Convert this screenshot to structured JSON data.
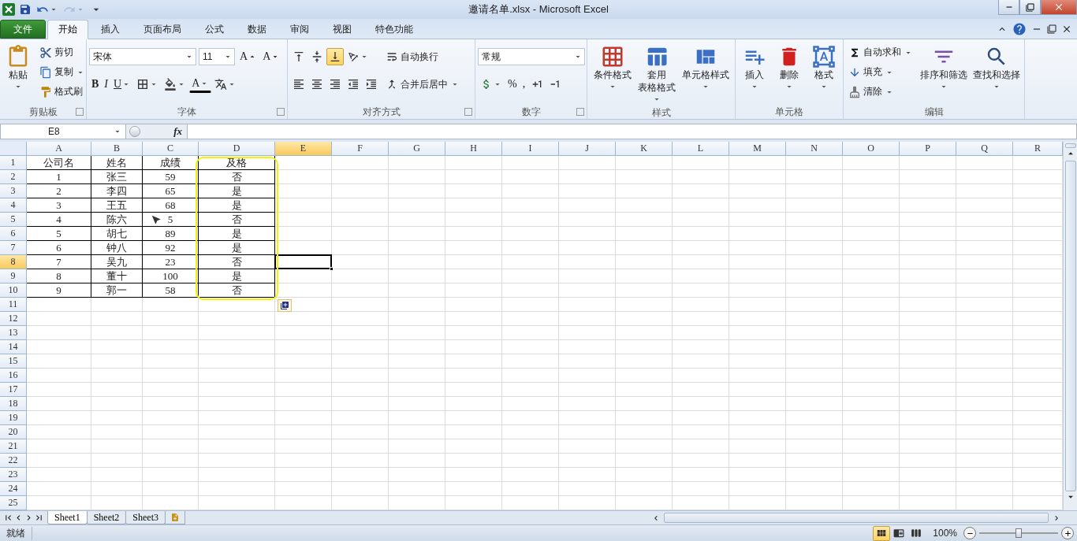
{
  "title_bar": {
    "title": "邀请名单.xlsx - Microsoft Excel",
    "quick_access": [
      {
        "kind": "save",
        "menu": false,
        "disabled": false
      },
      {
        "kind": "undo",
        "menu": true,
        "disabled": false
      },
      {
        "kind": "redo",
        "menu": true,
        "disabled": true
      },
      {
        "kind": "customize",
        "menu": false,
        "disabled": false
      }
    ]
  },
  "tabs": [
    {
      "label": "文件",
      "kind": "file",
      "selected": false
    },
    {
      "label": "开始",
      "kind": "tab",
      "selected": true
    },
    {
      "label": "插入",
      "kind": "tab",
      "selected": false
    },
    {
      "label": "页面布局",
      "kind": "tab",
      "selected": false
    },
    {
      "label": "公式",
      "kind": "tab",
      "selected": false
    },
    {
      "label": "数据",
      "kind": "tab",
      "selected": false
    },
    {
      "label": "审阅",
      "kind": "tab",
      "selected": false
    },
    {
      "label": "视图",
      "kind": "tab",
      "selected": false
    },
    {
      "label": "特色功能",
      "kind": "tab",
      "selected": false
    }
  ],
  "ribbon": [
    {
      "label": "剪贴板",
      "launcher": true,
      "sections": [
        {
          "kind": "large",
          "items": [
            {
              "kind": "paste",
              "lines": [
                "粘贴"
              ],
              "menu": true
            }
          ]
        },
        {
          "kind": "stack",
          "lines": [
            {
              "items": [
                {
                  "kind": "cut",
                  "label": "剪切",
                  "menu": false
                }
              ]
            },
            {
              "items": [
                {
                  "kind": "copy",
                  "label": "复制",
                  "menu": true
                }
              ]
            },
            {
              "items": [
                {
                  "kind": "painter",
                  "label": "格式刷",
                  "menu": false
                }
              ]
            }
          ]
        }
      ]
    },
    {
      "label": "字体",
      "launcher": true,
      "sections": [
        {
          "kind": "stack",
          "lines": [
            {
              "items": [
                {
                  "kind": "combo",
                  "value": "宋体",
                  "wide": true
                },
                {
                  "kind": "combo",
                  "value": "11",
                  "wide": false
                },
                {
                  "kind": "grow",
                  "text": "A",
                  "menu": false,
                  "selected": false
                },
                {
                  "kind": "shrink",
                  "text": "A",
                  "menu": false,
                  "selected": false
                }
              ]
            },
            {
              "items": [
                {
                  "kind": "bold",
                  "text": "B",
                  "menu": false,
                  "selected": false
                },
                {
                  "kind": "italic",
                  "text": "I",
                  "menu": false,
                  "selected": false
                },
                {
                  "kind": "underline",
                  "text": "U",
                  "menu": true,
                  "selected": false
                },
                {
                  "kind": "border",
                  "menu": true,
                  "selected": false
                },
                {
                  "kind": "fill",
                  "menu": true,
                  "selected": false
                },
                {
                  "kind": "fontcolor",
                  "text": "A",
                  "menu": true,
                  "selected": false
                },
                {
                  "kind": "phonetic",
                  "menu": true,
                  "selected": false
                }
              ]
            }
          ]
        }
      ]
    },
    {
      "label": "对齐方式",
      "launcher": true,
      "sections": [
        {
          "kind": "stack",
          "lines": [
            {
              "items": [
                {
                  "kind": "top",
                  "menu": false,
                  "selected": false
                },
                {
                  "kind": "middle",
                  "menu": false,
                  "selected": false
                },
                {
                  "kind": "bottom",
                  "menu": false,
                  "selected": true
                },
                {
                  "kind": "orient",
                  "menu": true,
                  "selected": false
                }
              ]
            },
            {
              "items": [
                {
                  "kind": "left",
                  "menu": false,
                  "selected": false
                },
                {
                  "kind": "center",
                  "menu": false,
                  "selected": false
                },
                {
                  "kind": "right",
                  "menu": false,
                  "selected": false
                },
                {
                  "kind": "outdent",
                  "menu": false,
                  "selected": false
                },
                {
                  "kind": "indent",
                  "menu": false,
                  "selected": false
                }
              ]
            }
          ]
        },
        {
          "kind": "stack",
          "lines": [
            {
              "items": [
                {
                  "kind": "wrap",
                  "label": "自动换行",
                  "menu": false
                }
              ]
            },
            {
              "items": [
                {
                  "kind": "merge",
                  "label": "合并后居中",
                  "menu": true
                }
              ]
            }
          ]
        }
      ]
    },
    {
      "label": "数字",
      "launcher": true,
      "sections": [
        {
          "kind": "stack",
          "lines": [
            {
              "items": [
                {
                  "kind": "combo",
                  "value": "常规",
                  "wide": true
                }
              ]
            },
            {
              "items": [
                {
                  "kind": "currency",
                  "menu": true,
                  "selected": false
                },
                {
                  "kind": "percent",
                  "text": "%",
                  "menu": false,
                  "selected": false
                },
                {
                  "kind": "comma",
                  "text": ",",
                  "menu": false,
                  "selected": false
                },
                {
                  "kind": "incdec",
                  "menu": false,
                  "selected": false
                },
                {
                  "kind": "decdec",
                  "menu": false,
                  "selected": false
                }
              ]
            }
          ]
        }
      ]
    },
    {
      "label": "样式",
      "launcher": false,
      "sections": [
        {
          "kind": "large",
          "items": [
            {
              "kind": "conditional",
              "lines": [
                "条件格式"
              ],
              "menu": true
            },
            {
              "kind": "tableformat",
              "lines": [
                "套用",
                "表格格式"
              ],
              "menu": true
            },
            {
              "kind": "cellstyle",
              "lines": [
                "单元格样式"
              ],
              "menu": true
            }
          ]
        }
      ]
    },
    {
      "label": "单元格",
      "launcher": false,
      "sections": [
        {
          "kind": "large",
          "items": [
            {
              "kind": "insert",
              "lines": [
                "插入"
              ],
              "menu": true
            },
            {
              "kind": "delete",
              "lines": [
                "删除"
              ],
              "menu": true
            },
            {
              "kind": "format",
              "lines": [
                "格式"
              ],
              "menu": true
            }
          ]
        }
      ]
    },
    {
      "label": "编辑",
      "launcher": false,
      "sections": [
        {
          "kind": "stack",
          "lines": [
            {
              "items": [
                {
                  "kind": "sum",
                  "label": "自动求和",
                  "menu": true
                }
              ]
            },
            {
              "items": [
                {
                  "kind": "filldown",
                  "label": "填充",
                  "menu": true
                }
              ]
            },
            {
              "items": [
                {
                  "kind": "clear",
                  "label": "清除",
                  "menu": true
                }
              ]
            }
          ]
        },
        {
          "kind": "large",
          "items": [
            {
              "kind": "sort",
              "lines": [
                "排序和筛选"
              ],
              "menu": true
            },
            {
              "kind": "find",
              "lines": [
                "查找和选择"
              ],
              "menu": true
            }
          ]
        }
      ]
    }
  ],
  "formula_bar": {
    "name_box": "E8",
    "fx": "fx"
  },
  "columns": [
    {
      "label": "A",
      "selected": false,
      "highlighted": false
    },
    {
      "label": "B",
      "selected": false,
      "highlighted": false
    },
    {
      "label": "C",
      "selected": false,
      "highlighted": false
    },
    {
      "label": "D",
      "selected": false,
      "highlighted": true
    },
    {
      "label": "E",
      "selected": true,
      "highlighted": false
    },
    {
      "label": "F",
      "selected": false,
      "highlighted": false
    },
    {
      "label": "G",
      "selected": false,
      "highlighted": false
    },
    {
      "label": "H",
      "selected": false,
      "highlighted": false
    },
    {
      "label": "I",
      "selected": false,
      "highlighted": false
    },
    {
      "label": "J",
      "selected": false,
      "highlighted": false
    },
    {
      "label": "K",
      "selected": false,
      "highlighted": false
    },
    {
      "label": "L",
      "selected": false,
      "highlighted": false
    },
    {
      "label": "M",
      "selected": false,
      "highlighted": false
    },
    {
      "label": "N",
      "selected": false,
      "highlighted": false
    },
    {
      "label": "O",
      "selected": false,
      "highlighted": false
    },
    {
      "label": "P",
      "selected": false,
      "highlighted": false
    },
    {
      "label": "Q",
      "selected": false,
      "highlighted": false
    },
    {
      "label": "R",
      "selected": false,
      "highlighted": false
    }
  ],
  "rows": [
    {
      "header": "1",
      "selected": false,
      "cells": [
        "公司名",
        "姓名",
        "成绩",
        "及格"
      ]
    },
    {
      "header": "2",
      "selected": false,
      "cells": [
        "1",
        "张三",
        "59",
        "否"
      ]
    },
    {
      "header": "3",
      "selected": false,
      "cells": [
        "2",
        "李四",
        "65",
        "是"
      ]
    },
    {
      "header": "4",
      "selected": false,
      "cells": [
        "3",
        "王五",
        "68",
        "是"
      ]
    },
    {
      "header": "5",
      "selected": false,
      "cells": [
        "4",
        "陈六",
        "5",
        "否"
      ]
    },
    {
      "header": "6",
      "selected": false,
      "cells": [
        "5",
        "胡七",
        "89",
        "是"
      ]
    },
    {
      "header": "7",
      "selected": false,
      "cells": [
        "6",
        "钟八",
        "92",
        "是"
      ]
    },
    {
      "header": "8",
      "selected": true,
      "cells": [
        "7",
        "吴九",
        "23",
        "否"
      ]
    },
    {
      "header": "9",
      "selected": false,
      "cells": [
        "8",
        "董十",
        "100",
        "是"
      ]
    },
    {
      "header": "10",
      "selected": false,
      "cells": [
        "9",
        "郭一",
        "58",
        "否"
      ]
    },
    {
      "header": "11",
      "selected": false,
      "cells": []
    },
    {
      "header": "12",
      "selected": false,
      "cells": []
    },
    {
      "header": "13",
      "selected": false,
      "cells": []
    },
    {
      "header": "14",
      "selected": false,
      "cells": []
    },
    {
      "header": "15",
      "selected": false,
      "cells": []
    },
    {
      "header": "16",
      "selected": false,
      "cells": []
    },
    {
      "header": "17",
      "selected": false,
      "cells": []
    },
    {
      "header": "18",
      "selected": false,
      "cells": []
    },
    {
      "header": "19",
      "selected": false,
      "cells": []
    },
    {
      "header": "20",
      "selected": false,
      "cells": []
    },
    {
      "header": "21",
      "selected": false,
      "cells": []
    },
    {
      "header": "22",
      "selected": false,
      "cells": []
    },
    {
      "header": "23",
      "selected": false,
      "cells": []
    },
    {
      "header": "24",
      "selected": false,
      "cells": []
    },
    {
      "header": "25",
      "selected": false,
      "cells": []
    }
  ],
  "sheets": [
    {
      "label": "Sheet1",
      "selected": true
    },
    {
      "label": "Sheet2",
      "selected": false
    },
    {
      "label": "Sheet3",
      "selected": false
    }
  ],
  "status_bar": {
    "status": "就绪",
    "views": [
      {
        "kind": "normal",
        "selected": true
      },
      {
        "kind": "layout",
        "selected": false
      },
      {
        "kind": "pagebreak",
        "selected": false
      }
    ],
    "zoom": "100%",
    "zoom_slider": {
      "level": 0.5
    }
  }
}
